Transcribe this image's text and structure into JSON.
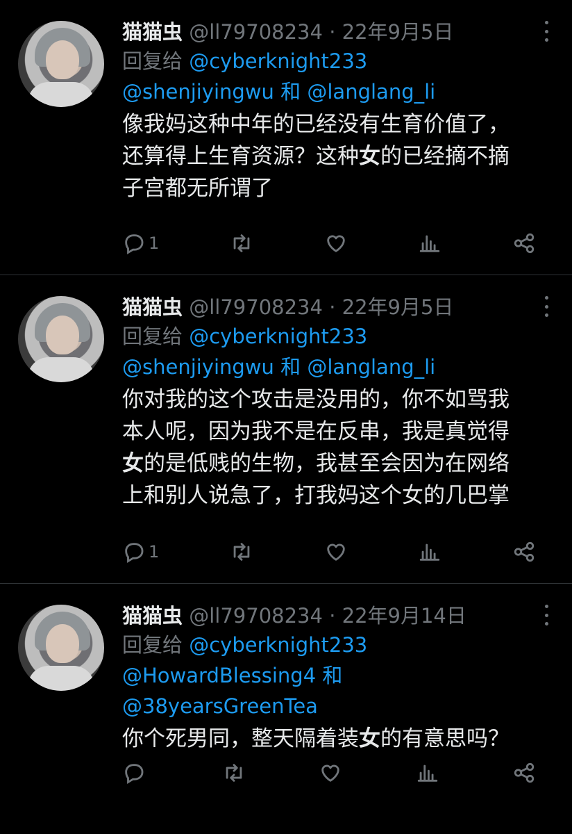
{
  "tweets": [
    {
      "name": "猫猫虫",
      "handle": "@ll79708234",
      "sep": "·",
      "date": "22年9月5日",
      "reply_prefix": "回复给 ",
      "reply_line1_mention": "@cyberknight233",
      "reply_line2_a": "@shenjiyingwu",
      "reply_and": " 和 ",
      "reply_line2_b": "@langlang_li",
      "body": [
        [
          "像我妈这种中年的已经没有生育价值了，"
        ],
        [
          "还算得上生育资源？这种",
          "女",
          "的已经摘不摘"
        ],
        [
          "子宫都无所谓了"
        ]
      ],
      "reply_count": "1"
    },
    {
      "name": "猫猫虫",
      "handle": "@ll79708234",
      "sep": "·",
      "date": "22年9月5日",
      "reply_prefix": "回复给 ",
      "reply_line1_mention": "@cyberknight233",
      "reply_line2_a": "@shenjiyingwu",
      "reply_and": " 和 ",
      "reply_line2_b": "@langlang_li",
      "body": [
        [
          "你对我的这个攻击是没用的，你不如骂我"
        ],
        [
          "本人呢，因为我不是在反串，我是真觉得"
        ],
        [
          "",
          "女",
          "的是低贱的生物，我甚至会因为在网络"
        ],
        [
          "上和别人说急了，打我妈这个女的几巴掌"
        ]
      ],
      "reply_count": "1"
    },
    {
      "name": "猫猫虫",
      "handle": "@ll79708234",
      "sep": "·",
      "date": "22年9月14日",
      "reply_prefix": "回复给 ",
      "reply_line1_mention": "@cyberknight233",
      "reply_line2_a": "@HowardBlessing4",
      "reply_and": " 和",
      "reply_line3": "@38yearsGreenTea",
      "body": [
        [
          "你个死男同，整天隔着装",
          "女",
          "的有意思吗？"
        ]
      ],
      "reply_count": ""
    }
  ],
  "icons": {
    "reply": "reply-icon",
    "retweet": "retweet-icon",
    "like": "like-icon",
    "views": "views-icon",
    "share": "share-icon",
    "more": "more-icon"
  },
  "colors": {
    "background": "#000000",
    "text": "#e7e9ea",
    "muted": "#71767b",
    "link": "#1d9bf0",
    "divider": "#2f3336"
  }
}
